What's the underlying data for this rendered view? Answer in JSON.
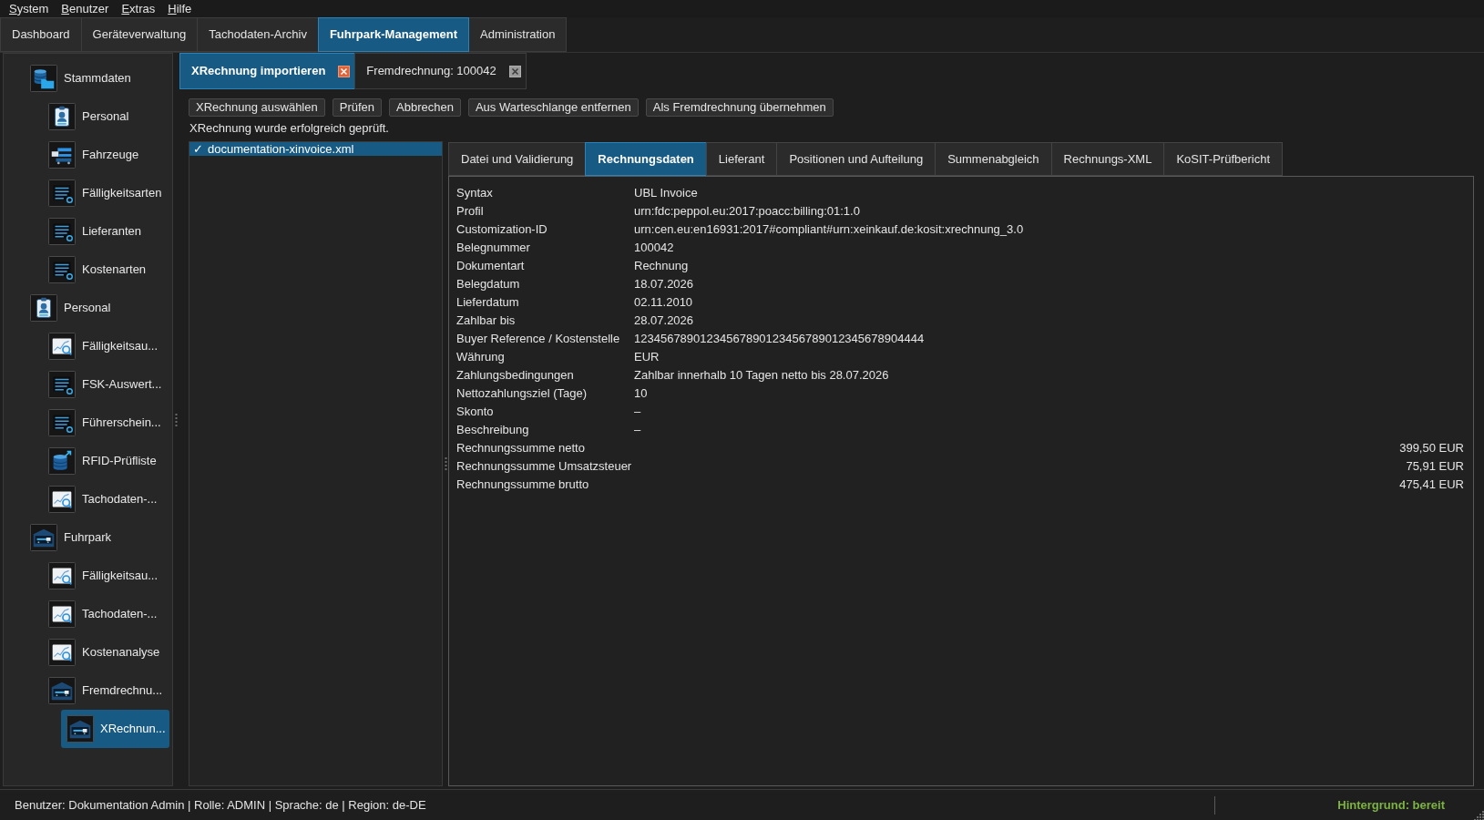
{
  "menu": [
    "System",
    "Benutzer",
    "Extras",
    "Hilfe"
  ],
  "main_tabs": [
    {
      "label": "Dashboard",
      "selected": false
    },
    {
      "label": "Geräteverwaltung",
      "selected": false
    },
    {
      "label": "Tachodaten-Archiv",
      "selected": false
    },
    {
      "label": "Fuhrpark-Management",
      "selected": true
    },
    {
      "label": "Administration",
      "selected": false
    }
  ],
  "sidebar": {
    "items": [
      {
        "label": "Stammdaten",
        "kind": "database",
        "selected": false,
        "children": [
          {
            "label": "Personal",
            "kind": "badge",
            "selected": false
          },
          {
            "label": "Fahrzeuge",
            "kind": "vehicles",
            "selected": false
          },
          {
            "label": "Fälligkeitsarten",
            "kind": "list",
            "selected": false
          },
          {
            "label": "Lieferanten",
            "kind": "list",
            "selected": false
          },
          {
            "label": "Kostenarten",
            "kind": "list",
            "selected": false
          }
        ]
      },
      {
        "label": "Personal",
        "kind": "badge",
        "selected": false,
        "children": [
          {
            "label": "Fälligkeitsau...",
            "kind": "chart",
            "selected": false
          },
          {
            "label": "FSK-Auswert...",
            "kind": "list",
            "selected": false
          },
          {
            "label": "Führerschein...",
            "kind": "list",
            "selected": false
          },
          {
            "label": "RFID-Prüfliste",
            "kind": "export",
            "selected": false
          },
          {
            "label": "Tachodaten-...",
            "kind": "chart",
            "selected": false
          }
        ]
      },
      {
        "label": "Fuhrpark",
        "kind": "garage",
        "selected": false,
        "children": [
          {
            "label": "Fälligkeitsau...",
            "kind": "chart",
            "selected": false
          },
          {
            "label": "Tachodaten-...",
            "kind": "chart",
            "selected": false
          },
          {
            "label": "Kostenanalyse",
            "kind": "chart",
            "selected": false
          },
          {
            "label": "Fremdrechnu...",
            "kind": "garage",
            "selected": false,
            "children": [
              {
                "label": "XRechnun...",
                "kind": "garage",
                "selected": true
              }
            ]
          }
        ]
      }
    ]
  },
  "document_tabs": [
    {
      "label": "XRechnung importieren",
      "selected": true
    },
    {
      "label": "Fremdrechnung: 100042",
      "selected": false
    }
  ],
  "toolbar": {
    "buttons": [
      "XRechnung auswählen",
      "Prüfen",
      "Abbrechen",
      "Aus Warteschlange entfernen",
      "Als Fremdrechnung übernehmen"
    ]
  },
  "status_message": "XRechnung wurde erfolgreich geprüft.",
  "file_list": {
    "items": [
      {
        "check": "✓",
        "name": "documentation-xinvoice.xml",
        "selected": true
      }
    ]
  },
  "detail_tabs": [
    {
      "label": "Datei und Validierung",
      "selected": false
    },
    {
      "label": "Rechnungsdaten",
      "selected": true
    },
    {
      "label": "Lieferant",
      "selected": false
    },
    {
      "label": "Positionen und Aufteilung",
      "selected": false
    },
    {
      "label": "Summenabgleich",
      "selected": false
    },
    {
      "label": "Rechnungs-XML",
      "selected": false
    },
    {
      "label": "KoSIT-Prüfbericht",
      "selected": false
    }
  ],
  "invoice_fields": [
    {
      "label": "Syntax",
      "value": "UBL Invoice"
    },
    {
      "label": "Profil",
      "value": "urn:fdc:peppol.eu:2017:poacc:billing:01:1.0"
    },
    {
      "label": "Customization-ID",
      "value": "urn:cen.eu:en16931:2017#compliant#urn:xeinkauf.de:kosit:xrechnung_3.0"
    },
    {
      "label": "Belegnummer",
      "value": "100042"
    },
    {
      "label": "Dokumentart",
      "value": "Rechnung"
    },
    {
      "label": "Belegdatum",
      "value": "18.07.2026"
    },
    {
      "label": "Lieferdatum",
      "value": "02.11.2010"
    },
    {
      "label": "Zahlbar bis",
      "value": "28.07.2026"
    },
    {
      "label": "Buyer Reference / Kostenstelle",
      "value": "12345678901234567890123456789012345678904444"
    },
    {
      "label": "Währung",
      "value": "EUR"
    },
    {
      "label": "Zahlungsbedingungen",
      "value": "Zahlbar innerhalb 10 Tagen netto bis 28.07.2026"
    },
    {
      "label": "Nettozahlungsziel (Tage)",
      "value": "10"
    },
    {
      "label": "Skonto",
      "value": "–"
    },
    {
      "label": "Beschreibung",
      "value": "–"
    }
  ],
  "invoice_totals": [
    {
      "label": "Rechnungssumme netto",
      "value": "399,50 EUR"
    },
    {
      "label": "Rechnungssumme Umsatzsteuer",
      "value": "75,91 EUR"
    },
    {
      "label": "Rechnungssumme brutto",
      "value": "475,41 EUR"
    }
  ],
  "status_bar": {
    "session_info": "Benutzer: Dokumentation Admin | Rolle: ADMIN | Sprache: de | Region: de-DE",
    "background_status": "Hintergrund: bereit"
  }
}
